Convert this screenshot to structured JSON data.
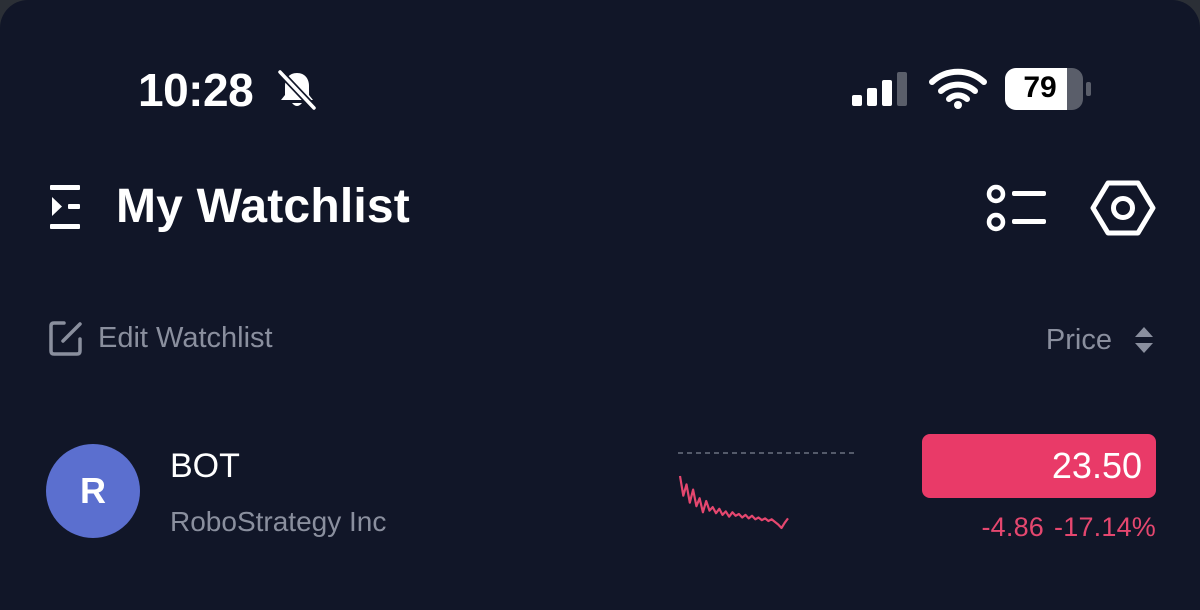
{
  "status_bar": {
    "time": "10:28",
    "battery_percent": "79",
    "icons": [
      "bell-slash-icon",
      "cellular-signal-icon",
      "wifi-icon",
      "battery-icon"
    ]
  },
  "header": {
    "title": "My Watchlist",
    "icons": [
      "menu-collapse-icon",
      "list-view-icon",
      "settings-icon"
    ]
  },
  "subheader": {
    "edit_label": "Edit Watchlist",
    "sort_label": "Price",
    "icons": [
      "edit-icon",
      "sort-icon"
    ]
  },
  "watchlist": [
    {
      "avatar_letter": "R",
      "ticker": "BOT",
      "company": "RoboStrategy Inc",
      "price": "23.50",
      "change": "-4.86",
      "change_percent": "-17.14%",
      "trend": "down",
      "sparkline": [
        28.36,
        26.1,
        27.4,
        25.3,
        26.8,
        24.9,
        25.8,
        24.2,
        25.5,
        24.4,
        24.8,
        24.1,
        24.6,
        23.9,
        24.3,
        23.7,
        24.2,
        23.8,
        24.0,
        23.6,
        23.9,
        23.5,
        23.8,
        23.4,
        23.6,
        23.3,
        23.5,
        23.2,
        23.4,
        23.1,
        22.8,
        22.4,
        23.0,
        23.5
      ]
    }
  ],
  "colors": {
    "background": "#111628",
    "accent_negative": "#e93a68",
    "negative_text": "#e5476f",
    "muted_text": "#8a8f9e",
    "avatar": "#5b6fcf"
  }
}
